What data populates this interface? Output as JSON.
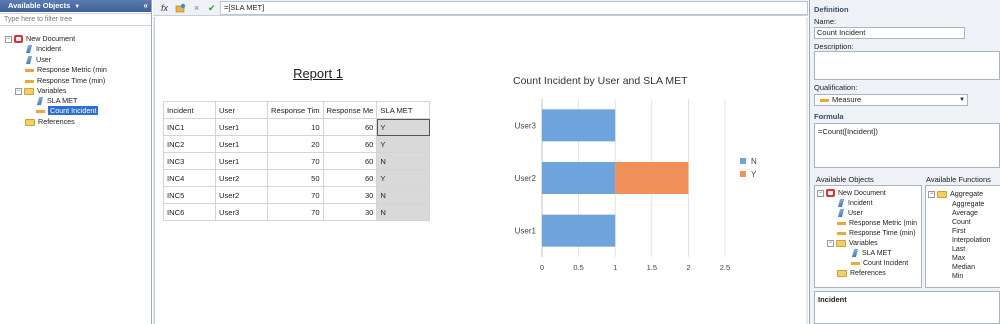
{
  "left_panel": {
    "title": "Available Objects",
    "filter_placeholder": "Type here to filter tree",
    "tree": [
      {
        "label": "New Document",
        "icon": "document-icon"
      },
      {
        "label": "Incident",
        "icon": "dimension-icon"
      },
      {
        "label": "User",
        "icon": "dimension-icon"
      },
      {
        "label": "Response Metric (min",
        "icon": "measure-icon"
      },
      {
        "label": "Response Time (min)",
        "icon": "measure-icon"
      },
      {
        "label": "Variables",
        "icon": "folder-icon"
      },
      {
        "label": "SLA MET",
        "icon": "dimension-icon"
      },
      {
        "label": "Count Incident",
        "icon": "measure-icon"
      },
      {
        "label": "References",
        "icon": "folder-icon"
      }
    ]
  },
  "toolbar": {
    "formula": "=[SLA MET]",
    "fx": "fx",
    "cancel": "×",
    "validate": "✔"
  },
  "report": {
    "title": "Report 1",
    "columns": [
      "Incident",
      "User",
      "Response Tim",
      "Response Me",
      "SLA MET"
    ],
    "rows": [
      [
        "INC1",
        "User1",
        "10",
        "60",
        "Y"
      ],
      [
        "INC2",
        "User1",
        "20",
        "60",
        "Y"
      ],
      [
        "INC3",
        "User1",
        "70",
        "60",
        "N"
      ],
      [
        "INC4",
        "User2",
        "50",
        "60",
        "Y"
      ],
      [
        "INC5",
        "User2",
        "70",
        "30",
        "N"
      ],
      [
        "INC6",
        "User3",
        "70",
        "30",
        "N"
      ]
    ]
  },
  "chart_data": {
    "type": "bar",
    "orientation": "horizontal",
    "stacked": true,
    "title": "Count Incident by User and SLA MET",
    "categories": [
      "User3",
      "User2",
      "User1"
    ],
    "series": [
      {
        "name": "N",
        "values": [
          1,
          1,
          1
        ],
        "color": "#6fa3dc"
      },
      {
        "name": "Y",
        "values": [
          0,
          1,
          0
        ],
        "color": "#f0905b"
      }
    ],
    "xlim": [
      0,
      2.5
    ],
    "xticks": [
      "0",
      "0.5",
      "1",
      "1.5",
      "2",
      "2.5"
    ],
    "grid": true,
    "legend": "right"
  },
  "right_panel": {
    "definition_heading": "Definition",
    "name_label": "Name:",
    "name_value": "Count Incident",
    "description_label": "Description:",
    "qualification_label": "Qualification:",
    "qualification_value": "Measure",
    "formula_heading": "Formula",
    "formula_value": "=Count([Incident])",
    "objects_heading": "Available Objects",
    "functions_heading": "Available Functions",
    "objects_tree": [
      {
        "label": "New Document"
      },
      {
        "label": "Incident"
      },
      {
        "label": "User"
      },
      {
        "label": "Response Metric (min"
      },
      {
        "label": "Response Time (min)"
      },
      {
        "label": "Variables"
      },
      {
        "label": "SLA MET"
      },
      {
        "label": "Count Incident"
      },
      {
        "label": "References"
      }
    ],
    "functions": [
      "Aggregate",
      "Aggregate",
      "Average",
      "Count",
      "First",
      "Interpolation",
      "Last",
      "Max",
      "Median",
      "Min"
    ],
    "help_title": "Incident"
  }
}
